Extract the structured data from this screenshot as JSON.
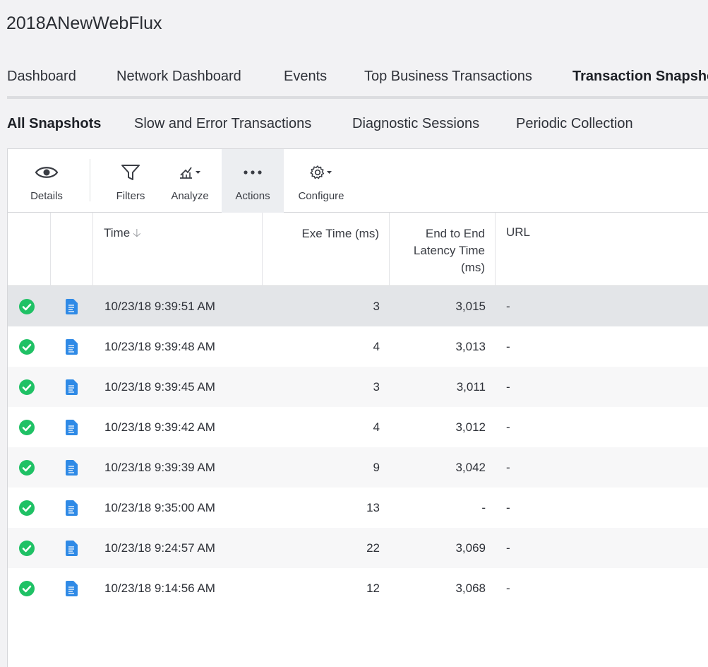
{
  "app": {
    "title": "2018ANewWebFlux"
  },
  "tabs": [
    {
      "label": "Dashboard"
    },
    {
      "label": "Network Dashboard"
    },
    {
      "label": "Events"
    },
    {
      "label": "Top Business Transactions"
    },
    {
      "label": "Transaction Snapshots"
    }
  ],
  "subtabs": [
    {
      "label": "All Snapshots"
    },
    {
      "label": "Slow and Error Transactions"
    },
    {
      "label": "Diagnostic Sessions"
    },
    {
      "label": "Periodic Collection"
    }
  ],
  "toolbar": {
    "details": "Details",
    "filters": "Filters",
    "analyze": "Analyze",
    "actions": "Actions",
    "configure": "Configure"
  },
  "table": {
    "headers": {
      "time": "Time",
      "exe_time": "Exe Time (ms)",
      "e2e_line1": "End to End",
      "e2e_line2": "Latency Time",
      "e2e_line3": "(ms)",
      "url": "URL"
    },
    "rows": [
      {
        "time": "10/23/18 9:39:51 AM",
        "exe": "3",
        "e2e": "3,015",
        "url": "-"
      },
      {
        "time": "10/23/18 9:39:48 AM",
        "exe": "4",
        "e2e": "3,013",
        "url": "-"
      },
      {
        "time": "10/23/18 9:39:45 AM",
        "exe": "3",
        "e2e": "3,011",
        "url": "-"
      },
      {
        "time": "10/23/18 9:39:42 AM",
        "exe": "4",
        "e2e": "3,012",
        "url": "-"
      },
      {
        "time": "10/23/18 9:39:39 AM",
        "exe": "9",
        "e2e": "3,042",
        "url": "-"
      },
      {
        "time": "10/23/18 9:35:00 AM",
        "exe": "13",
        "e2e": "-",
        "url": "-"
      },
      {
        "time": "10/23/18 9:24:57 AM",
        "exe": "22",
        "e2e": "3,069",
        "url": "-"
      },
      {
        "time": "10/23/18 9:14:56 AM",
        "exe": "12",
        "e2e": "3,068",
        "url": "-"
      }
    ]
  },
  "colors": {
    "accent": "#7b6fe0",
    "status_ok": "#1fc165",
    "doc_icon": "#2f8ae6"
  }
}
